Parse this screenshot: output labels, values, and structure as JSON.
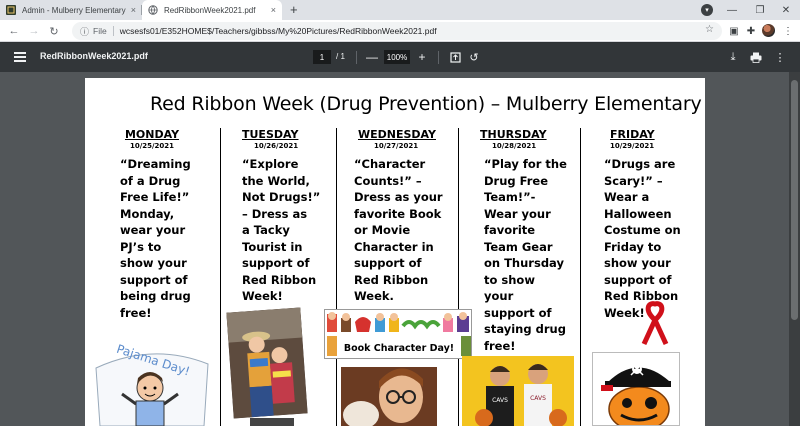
{
  "tabs": [
    {
      "title": "Admin - Mulberry Elementary Sc",
      "close": "×"
    },
    {
      "title": "RedRibbonWeek2021.pdf",
      "close": "×"
    }
  ],
  "new_tab": "+",
  "address": {
    "scheme": "File",
    "url": "wcsesfs01/E352HOME$/Teachers/gibbss/My%20Pictures/RedRibbonWeek2021.pdf"
  },
  "pdf_toolbar": {
    "title": "RedRibbonWeek2021.pdf",
    "page_current": "1",
    "page_total": "/ 1",
    "zoom": "100%",
    "zoom_out": "—",
    "zoom_in": "+"
  },
  "document": {
    "title": "Red Ribbon Week (Drug Prevention) – Mulberry Elementary",
    "columns": [
      {
        "day": "MONDAY",
        "date": "10/25/2021",
        "lines": [
          "“Dreaming",
          "of a Drug",
          "Free Life!”",
          "Monday,",
          "wear your",
          "PJ’s to",
          "show your",
          "support of",
          "being drug",
          "free!"
        ]
      },
      {
        "day": "TUESDAY",
        "date": "10/26/2021",
        "lines": [
          "“Explore",
          "the World,",
          "Not Drugs!”",
          "– Dress as",
          "a Tacky",
          "Tourist in",
          "support of",
          "Red Ribbon",
          "Week!"
        ]
      },
      {
        "day": "WEDNESDAY",
        "date": "10/27/2021",
        "lines": [
          "“Character",
          "Counts!” –",
          "Dress as your",
          "favorite Book",
          "or Movie",
          "Character in",
          "support of",
          "Red Ribbon",
          "Week."
        ]
      },
      {
        "day": "THURSDAY",
        "date": "10/28/2021",
        "lines": [
          "“Play for the",
          "Drug Free",
          "Team!”-",
          "Wear your",
          "favorite",
          "Team Gear",
          "on Thursday",
          "to show",
          "your",
          "support of",
          "staying drug",
          "free!"
        ]
      },
      {
        "day": "FRIDAY",
        "date": "10/29/2021",
        "lines": [
          "“Drugs are",
          "Scary!” –",
          "Wear a",
          "Halloween",
          "Costume on",
          "Friday to",
          "show your",
          "support of",
          "Red Ribbon",
          "Week!"
        ]
      }
    ],
    "images": {
      "pajama_banner": "Pajama Day!",
      "book_banner": "Book Character Day!"
    }
  },
  "colors": {
    "tabstrip": "#dee1e6",
    "pdf_toolbar": "#323639",
    "viewer_bg": "#525659",
    "ribbon_red": "#d0101a"
  }
}
